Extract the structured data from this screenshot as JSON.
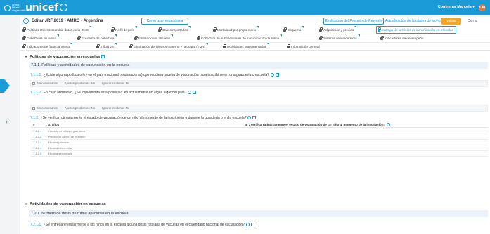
{
  "topbar": {
    "who_text": "World Health Organization",
    "brand": "unicef",
    "user_name": "Contreras Marcela",
    "user_initials": "CM"
  },
  "form": {
    "title": "Editar JRF 2019 - AMRO - Argentina",
    "help_label": "Cómo usar esta página",
    "process_label": "Explicación del Proceso de Revisión",
    "icon_update_label": "Actualización de la página de iconos",
    "update_label": "Validar",
    "close_label": "Cerrar"
  },
  "tabs": {
    "row1": [
      "Políticas Uso-Intercambio datos de la OMS",
      "Perfil de país",
      "Casos reportados",
      "Mortalidad por grupo etario",
      "Esquema",
      "Adquisición y precios",
      "Entrega de servicios de inmunización en escuelas"
    ],
    "row2": [
      "Coberturas de rutina",
      "Encuesta de cobertura",
      "Estimaciones oficiales",
      "Cobertura de subnacionales de inmunización de rutina",
      "Sistema de indicadores",
      "Indicadores de desempeño"
    ],
    "row3": [
      "Indicadores de financiamiento",
      "Influenza",
      "Eliminación del tétanos materno y neonatal (TMN)",
      "Actividades suplementarias",
      "Información general"
    ]
  },
  "content": {
    "section1": "Políticas de vacunación en escuelas",
    "sub1": "7.1.1. Políticas y actividades de vacunación en la escuela",
    "q1_num": "7.1.1.1.",
    "q1_text": "¿Existe alguna política o ley en el país (nacional o subnacional) que requiera prueba de vacunación para inscribirse en una guardería o escuela?",
    "ans1": {
      "comments": "Sin comentarios",
      "pending": "Ajustes pendientes: No",
      "ignore": "Ignorar incidente: No"
    },
    "q2_num": "7.1.1.2.",
    "q2_text": "En caso afirmativo, ¿Se implementa esta política o ley actualmente en algún lugar del país?",
    "ans2": {
      "comments": "Sin comentarios",
      "pending": "Ajustes pendientes: No",
      "ignore": "Ignorar incidente: No"
    },
    "q3_num": "7.1.2.",
    "q3_text": "¿Se verifica rutinariamente el estado de vacunación de un niño al momento de la inscripción o durante la guardería o en la escuela?",
    "table": {
      "col_num": "#",
      "col_a": "A. años",
      "col_b": "B. ¿Verifica rutinariamente el estado de vacunación de un niño al momento de la inscripción?",
      "rows": [
        {
          "num": "7.1.2.1",
          "text": "Cuidado de niños o guardería"
        },
        {
          "num": "7.1.2.2",
          "text": "Preescolar (jardín de infantes)"
        },
        {
          "num": "7.1.2.3",
          "text": "Escuela primaria"
        },
        {
          "num": "7.1.2.4",
          "text": "Escuela intermedia"
        },
        {
          "num": "7.1.2.5",
          "text": "Escuela secundaria"
        }
      ]
    },
    "section2": "Actividades de vacunación en escuelas",
    "sub2": "7.2.1. Número de dosis de rutina aplicadas en la escuela",
    "q4_num": "7.2.1.1.",
    "q4_text": "¿Se entregan regularmente a los niños en la escuela alguna dosis rutinaria de vacunas en el calendario nacional de vacunación?"
  }
}
